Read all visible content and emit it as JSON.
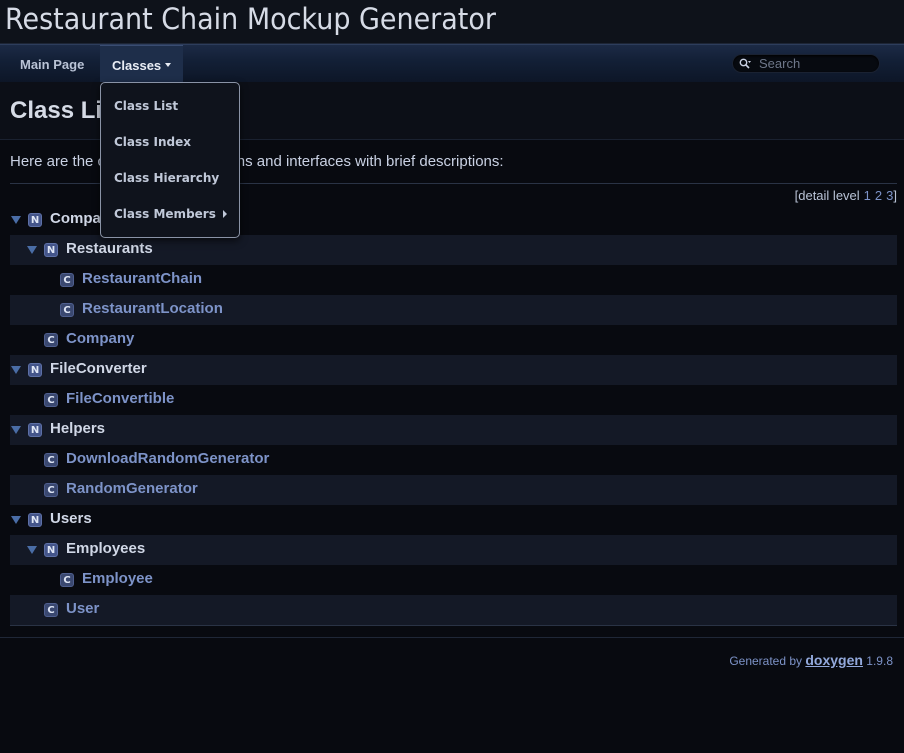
{
  "project": {
    "title": "Restaurant Chain Mockup Generator"
  },
  "navbar": {
    "items": [
      {
        "label": "Main Page",
        "active": false
      },
      {
        "label": "Classes",
        "active": true
      }
    ],
    "search": {
      "placeholder": "Search",
      "value": ""
    }
  },
  "dropdown": {
    "items": [
      {
        "label": "Class List",
        "has_submenu": false
      },
      {
        "label": "Class Index",
        "has_submenu": false
      },
      {
        "label": "Class Hierarchy",
        "has_submenu": false
      },
      {
        "label": "Class Members",
        "has_submenu": true
      }
    ]
  },
  "page": {
    "title": "Class List",
    "intro": "Here are the classes, structs, unions and interfaces with brief descriptions:",
    "detail_level": {
      "prefix": "[detail level",
      "levels": [
        "1",
        "2",
        "3"
      ],
      "suffix": "]"
    }
  },
  "tree": [
    {
      "kind": "N",
      "name": "Company",
      "depth": 0,
      "expanded": true
    },
    {
      "kind": "N",
      "name": "Restaurants",
      "depth": 1,
      "expanded": true
    },
    {
      "kind": "C",
      "name": "RestaurantChain",
      "depth": 2
    },
    {
      "kind": "C",
      "name": "RestaurantLocation",
      "depth": 2
    },
    {
      "kind": "C",
      "name": "Company",
      "depth": 1
    },
    {
      "kind": "N",
      "name": "FileConverter",
      "depth": 0,
      "expanded": true
    },
    {
      "kind": "C",
      "name": "FileConvertible",
      "depth": 1
    },
    {
      "kind": "N",
      "name": "Helpers",
      "depth": 0,
      "expanded": true
    },
    {
      "kind": "C",
      "name": "DownloadRandomGenerator",
      "depth": 1
    },
    {
      "kind": "C",
      "name": "RandomGenerator",
      "depth": 1
    },
    {
      "kind": "N",
      "name": "Users",
      "depth": 0,
      "expanded": true
    },
    {
      "kind": "N",
      "name": "Employees",
      "depth": 1,
      "expanded": true
    },
    {
      "kind": "C",
      "name": "Employee",
      "depth": 2
    },
    {
      "kind": "C",
      "name": "User",
      "depth": 1
    }
  ],
  "footer": {
    "generated_by": "Generated by",
    "tool": "doxygen",
    "version": "1.9.8"
  },
  "colors": {
    "background": "#080a10",
    "link": "#7d93c8",
    "navbar": "#132037"
  }
}
